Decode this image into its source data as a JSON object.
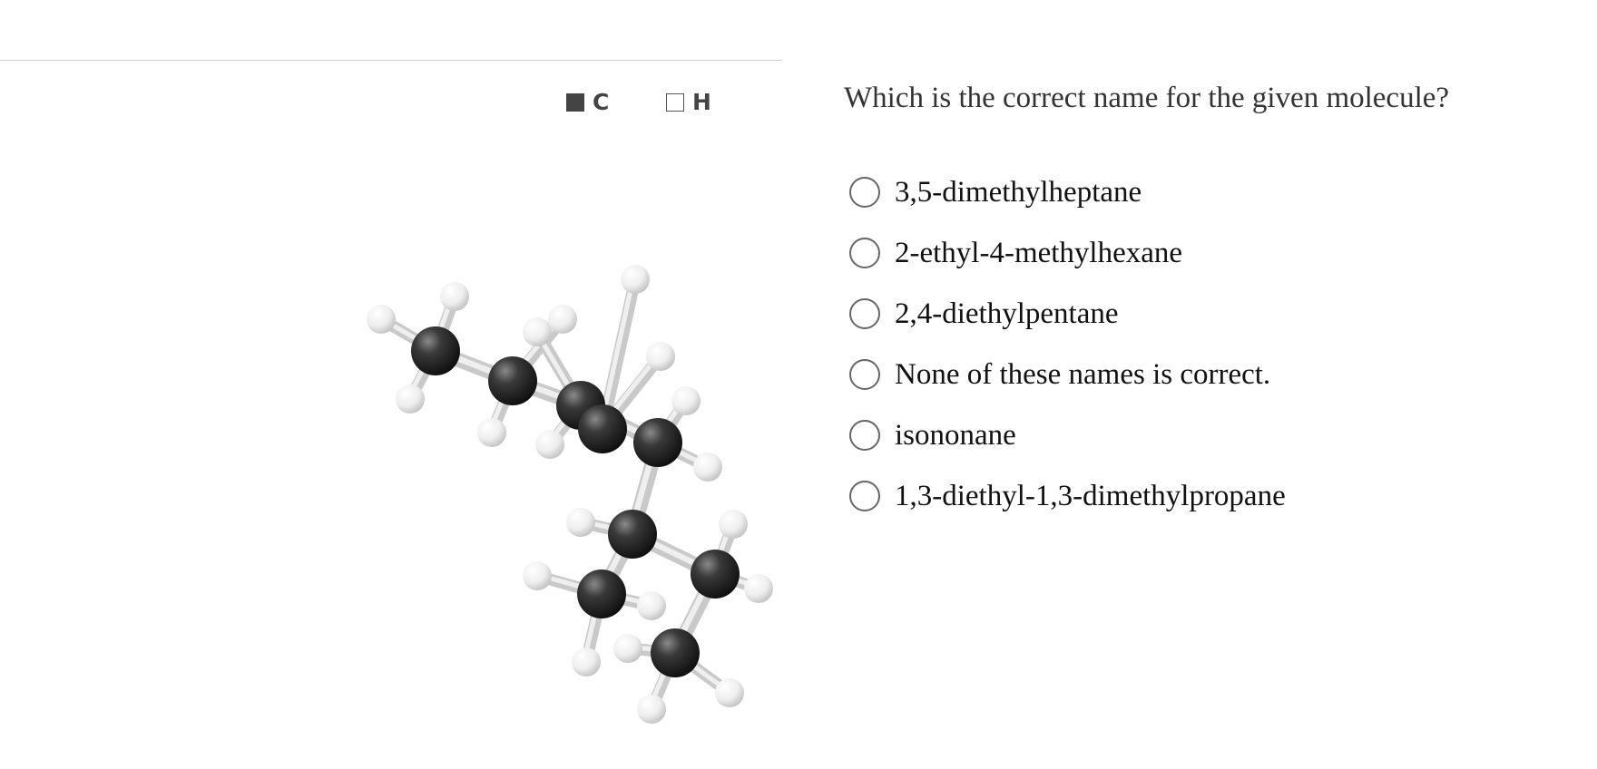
{
  "legend": {
    "carbon_label": "C",
    "hydrogen_label": "H",
    "carbon_color": "#444444",
    "hydrogen_color": "#ffffff"
  },
  "question": {
    "text": "Which is the correct name for the given molecule?",
    "choices": [
      "3,5-dimethylheptane",
      "2-ethyl-4-methylhexane",
      "2,4-diethylpentane",
      "None of these names is correct.",
      "isononane",
      "1,3-diethyl-1,3-dimethylpropane"
    ]
  },
  "molecule": {
    "atoms": {
      "carbon": 9,
      "hydrogen": 20
    },
    "icon": "ball-and-stick-3d-model"
  }
}
